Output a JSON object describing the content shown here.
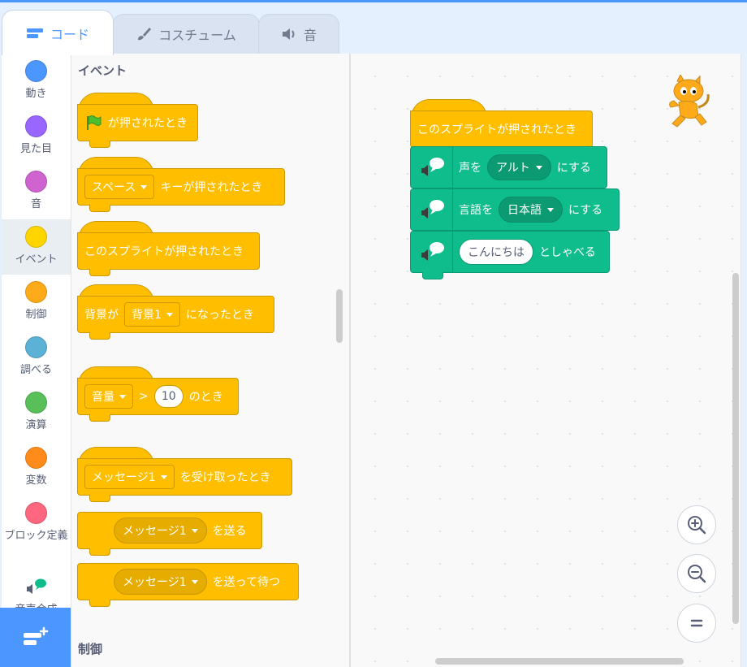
{
  "tabs": [
    {
      "label": "コード",
      "icon": "code-icon"
    },
    {
      "label": "コスチューム",
      "icon": "brush-icon"
    },
    {
      "label": "音",
      "icon": "speaker-icon"
    }
  ],
  "categories": [
    {
      "label": "動き",
      "color": "#4c97ff"
    },
    {
      "label": "見た目",
      "color": "#9966ff"
    },
    {
      "label": "音",
      "color": "#cf63cf"
    },
    {
      "label": "イベント",
      "color": "#ffd500"
    },
    {
      "label": "制御",
      "color": "#ffab19"
    },
    {
      "label": "調べる",
      "color": "#5cb1d6"
    },
    {
      "label": "演算",
      "color": "#59c059"
    },
    {
      "label": "変数",
      "color": "#ff8c1a"
    },
    {
      "label": "ブロック定義",
      "color": "#ff6680"
    },
    {
      "label": "音声合成",
      "color": "#0fbd8c"
    }
  ],
  "selected_category": "イベント",
  "palette": {
    "heading_events": "イベント",
    "heading_control": "制御",
    "blocks": {
      "flag_clicked": "が押されたとき",
      "key_dropdown": "スペース",
      "key_pressed": "キーが押されたとき",
      "sprite_clicked": "このスプライトが押されたとき",
      "backdrop_prefix": "背景が",
      "backdrop_dropdown": "背景1",
      "backdrop_suffix": "になったとき",
      "loudness_dropdown": "音量",
      "gt_symbol": ">",
      "loudness_value": "10",
      "loudness_suffix": "のとき",
      "receive_dropdown": "メッセージ1",
      "receive_suffix": "を受け取ったとき",
      "broadcast_dropdown": "メッセージ1",
      "broadcast_suffix": "を送る",
      "broadcast_wait_dropdown": "メッセージ1",
      "broadcast_wait_suffix": "を送って待つ"
    }
  },
  "script": {
    "hat": "このスプライトが押されたとき",
    "voice_prefix": "声を",
    "voice_value": "アルト",
    "voice_suffix": "にする",
    "lang_prefix": "言語を",
    "lang_value": "日本語",
    "lang_suffix": "にする",
    "speak_text": "こんにちは",
    "speak_suffix": "としゃべる"
  },
  "colors": {
    "event": "#ffbf00",
    "tts": "#0fbd8c",
    "accent": "#4c97ff"
  }
}
